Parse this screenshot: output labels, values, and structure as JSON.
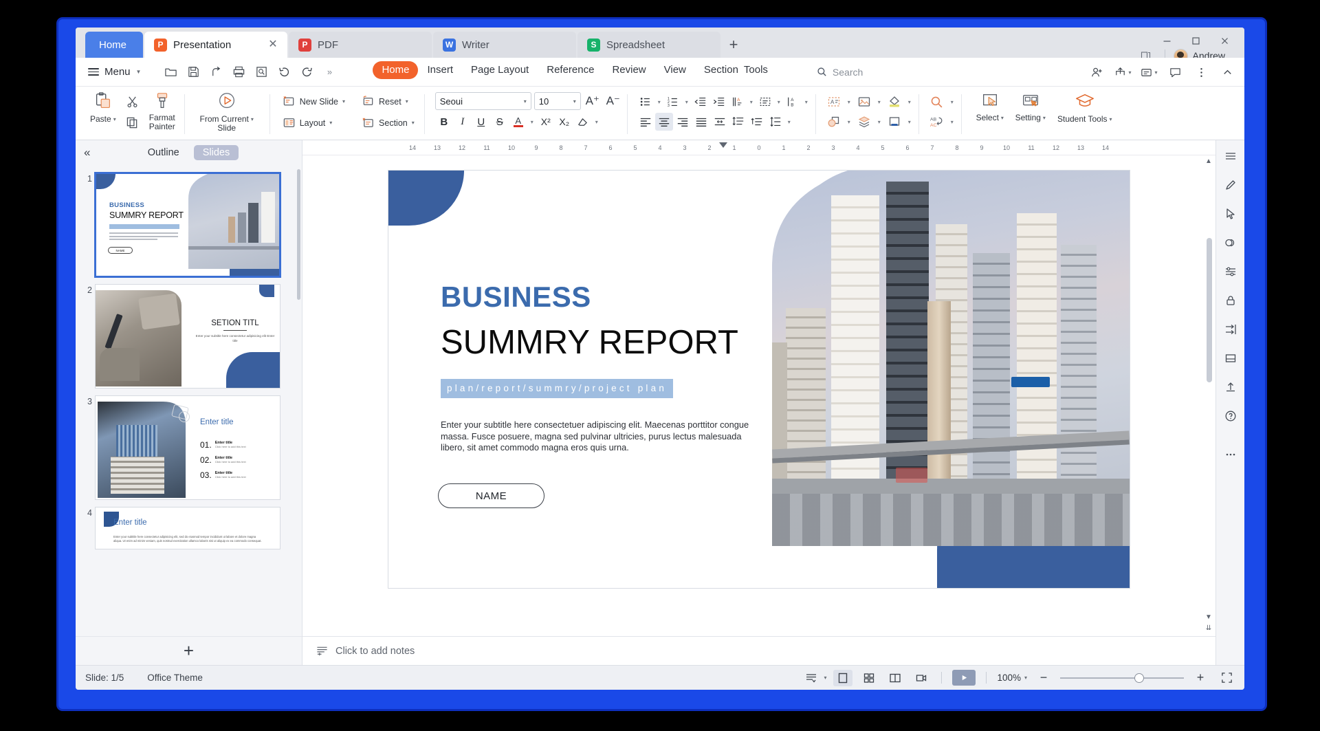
{
  "window": {
    "tabs": [
      {
        "label": "Home",
        "type": "home",
        "icon": "home-tab"
      },
      {
        "label": "Presentation",
        "type": "doc",
        "icon": "presentation-icon",
        "color": "#f2622b",
        "glyph": "P",
        "active": true,
        "closable": true
      },
      {
        "label": "PDF",
        "type": "doc",
        "icon": "pdf-icon",
        "color": "#e0403c",
        "glyph": "P",
        "active": false
      },
      {
        "label": "Writer",
        "type": "doc",
        "icon": "writer-icon",
        "color": "#3a72e0",
        "glyph": "W",
        "active": false
      },
      {
        "label": "Spreadsheet",
        "type": "doc",
        "icon": "spreadsheet-icon",
        "color": "#17b26a",
        "glyph": "S",
        "active": false
      }
    ],
    "new_tab_label": "+",
    "close_glyph": "✕",
    "minimize_label": "—",
    "maximize_label": "□",
    "close_label": "✕",
    "user_name": "Andrew"
  },
  "menubar": {
    "menu_label": "Menu",
    "quick_access": [
      "open-icon",
      "save-icon",
      "share-icon",
      "print-icon",
      "print-preview-icon",
      "undo-icon",
      "redo-icon",
      "more-icon"
    ],
    "ribbon_tabs": [
      {
        "label": "Home",
        "active": true
      },
      {
        "label": "Insert",
        "active": false
      },
      {
        "label": "Page Layout",
        "active": false
      },
      {
        "label": "Reference",
        "active": false
      },
      {
        "label": "Review",
        "active": false
      },
      {
        "label": "View",
        "active": false
      },
      {
        "label": "Section",
        "active": false
      },
      {
        "label": "Tools",
        "active": false
      }
    ],
    "search_placeholder": "Search",
    "right_icons": [
      "add-person-icon",
      "share-icon",
      "cloud-sync-icon",
      "comment-icon",
      "more-vertical-icon",
      "collapse-ribbon-icon"
    ]
  },
  "ribbon": {
    "clipboard": {
      "paste": "Paste",
      "copy": "copy-icon",
      "cut": "cut-icon",
      "format_painter_line1": "Farmat",
      "format_painter_line2": "Painter"
    },
    "slideshow": {
      "from_current_line1": "From Current",
      "from_current_line2": "Slide"
    },
    "slides": {
      "new_slide": "New Slide",
      "layout": "Layout",
      "reset": "Reset",
      "section": "Section"
    },
    "font": {
      "family": "Seoui",
      "size": "10",
      "grow": "A⁺",
      "shrink": "A⁻",
      "bold": "B",
      "italic": "I",
      "underline": "U",
      "strike": "S",
      "font_color": "A",
      "superscript": "X²",
      "subscript": "X₂",
      "clear_format": "clear-format-icon"
    },
    "paragraph": {
      "bullets": "bullet-list-icon",
      "numbering": "numbered-list-icon",
      "decrease_indent": "decrease-indent-icon",
      "increase_indent": "increase-indent-icon",
      "text_direction": "text-direction-icon",
      "text_box_align": "text-align-box-icon",
      "vertical_text": "vertical-text-icon",
      "align_left": "align-left-icon",
      "align_center": "align-center-icon",
      "align_right": "align-right-icon",
      "justify": "justify-icon",
      "distribute": "distribute-icon",
      "line_spacing_a": "line-spacing-a-icon",
      "line_spacing_b": "line-spacing-b-icon",
      "line_spacing_c": "line-spacing-c-icon"
    },
    "drawing": {
      "text_box": "text-box-icon",
      "picture": "picture-icon",
      "shape_fill": "shape-fill-icon",
      "shapes": "shapes-icon",
      "arrange": "arrange-icon",
      "shape_effects": "shape-effects-icon"
    },
    "editing": {
      "find": "find-icon",
      "replace": "replace-icon"
    },
    "tools": {
      "select": "Select",
      "setting": "Setting",
      "student_tools": "Student Tools"
    }
  },
  "slide_panel": {
    "collapse": "«",
    "tab_outline": "Outline",
    "tab_slides": "Slides",
    "add_slide": "+",
    "slides": [
      {
        "number": "1",
        "title": "BUSINESS / SUMMRY REPORT",
        "selected": true
      },
      {
        "number": "2",
        "title": "SETION TITL",
        "selected": false
      },
      {
        "number": "3",
        "title": "Enter title",
        "selected": false
      },
      {
        "number": "4",
        "title": "Enter title",
        "selected": false
      }
    ],
    "thumb2": {
      "title": "SETION TITL",
      "subtitle": "Enter your subtitle here consectetur adipisicing elit Enter title"
    },
    "thumb3": {
      "title": "Enter title",
      "items": [
        {
          "num": "01.",
          "head": "Enter title",
          "sub": "Click here to add this text"
        },
        {
          "num": "02.",
          "head": "Enter title",
          "sub": "Click here to add this text"
        },
        {
          "num": "03.",
          "head": "Enter title",
          "sub": "Click here to add this text"
        }
      ]
    },
    "thumb4": {
      "title": "Enter title",
      "body": "Enter your subtitle here consectetur adipisicing elit, sed do eiusmod tempor incididunt ut labore et dolore magna aliqua. Ut enim ad minim veniam, quis nostrud exercitation ullamco laboris nisi ut aliquip ex ea commodo consequat."
    }
  },
  "ruler": {
    "ticks": [
      "14",
      "13",
      "12",
      "11",
      "10",
      "9",
      "8",
      "7",
      "6",
      "5",
      "4",
      "3",
      "2",
      "1",
      "0",
      "1",
      "2",
      "3",
      "4",
      "5",
      "6",
      "7",
      "8",
      "9",
      "10",
      "11",
      "12",
      "13",
      "14"
    ]
  },
  "slide": {
    "eyebrow": "BUSINESS",
    "title": "SUMMRY REPORT",
    "tagline": "plan/report/summry/project  plan",
    "body": "Enter your subtitle here consectetuer adipiscing elit. Maecenas porttitor congue massa. Fusce posuere, magna sed pulvinar ultricies, purus lectus malesuada libero, sit amet commodo magna eros quis urna.",
    "button": "NAME",
    "accent_color": "#3a5f9e",
    "eyebrow_color": "#3b6bad",
    "tagline_bg": "#9fbde0"
  },
  "notes": {
    "placeholder": "Click to add notes",
    "icon": "notes-icon"
  },
  "status": {
    "slide_counter": "Slide: 1/5",
    "theme": "Office Theme",
    "view_normal": "normal-view-icon",
    "view_sorter": "slide-sorter-icon",
    "view_reading": "reading-view-icon",
    "view_record": "record-icon",
    "play": "play-icon",
    "zoom_level": "100%",
    "zoom_out": "−",
    "zoom_in": "+",
    "fit_window": "fit-to-window-icon"
  },
  "rail": {
    "items": [
      "menu-rail-icon",
      "pen-icon",
      "cursor-icon",
      "shapes-rail-icon",
      "adjust-icon",
      "lock-icon",
      "align-icon",
      "crop-icon",
      "export-icon",
      "help-icon",
      "more-rail-icon"
    ]
  }
}
